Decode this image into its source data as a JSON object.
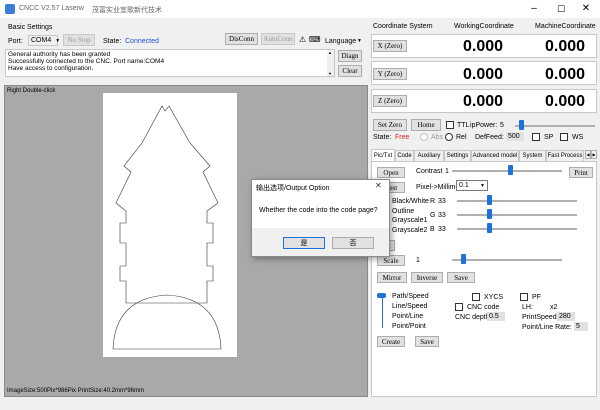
{
  "window": {
    "title": "CNCC V2.57 Laserw",
    "subtitle": "茂富实业宜歌新代技术"
  },
  "basic": {
    "section_label": "Basic Settings",
    "port_label": "Port:",
    "port_value": "COM4",
    "no_stop_label": "No Stop",
    "state_label": "State:",
    "state_value": "Connected",
    "disconn_label": "DisConn",
    "autoconn_label": "AutoConn",
    "language_label": "Language",
    "log_lines": [
      "General authority has been granted",
      "Successfully connected to the CNC. Port name:COM4",
      "Have access to configuration."
    ],
    "diagn_label": "Diagn",
    "clear_label": "Clear"
  },
  "canvas": {
    "hint": "Right Double-click",
    "status": "ImageSize:500Pix*986Pix  PrintSize:40.2mm*96mm"
  },
  "coords": {
    "system_label": "Coordinate System",
    "working_label": "WorkingCoordinate",
    "machine_label": "MachineCoordinate",
    "rows": [
      {
        "button": "X (Zero)",
        "working": "0.000",
        "machine": "0.000"
      },
      {
        "button": "Y (Zero)",
        "working": "0.000",
        "machine": "0.000"
      },
      {
        "button": "Z (Zero)",
        "working": "0.000",
        "machine": "0.000"
      }
    ]
  },
  "controls": {
    "set_zero": "Set Zero",
    "home": "Home",
    "ttl_label": "TTL",
    "ip_power_label": "ipPower:",
    "ip_power_value": "5",
    "state_label": "State:",
    "state_value": "Free",
    "abs_label": "Abs",
    "rel_label": "Rel",
    "def_feed_label": "DefFeed:",
    "def_feed_value": "500",
    "sp_label": "SP",
    "ws_label": "WS"
  },
  "tabs": [
    "Pic/Txt",
    "Code",
    "Auxiliary",
    "Settings",
    "Advanced model",
    "System",
    "Fast Process"
  ],
  "pic": {
    "open_label": "Open",
    "contrast_label": "Contrast",
    "contrast_value": "1",
    "print_label": "Print",
    "reset_label": "Rest",
    "pixel_label": "Pixel->Millimeter",
    "pixel_value": "0.1",
    "modes": [
      "Black/White",
      "Outline",
      "Grayscale1",
      "Grayscale2"
    ],
    "r_label": "R",
    "r_value": "33",
    "r_fraction": 0.13,
    "g_label": "G",
    "g_value": "33",
    "g_fraction": 0.13,
    "b_label": "B",
    "b_value": "33",
    "b_fraction": 0.13,
    "fr_label": "FR",
    "scale_label": "Scale",
    "scale_value": "1",
    "mirror_label": "Mirror",
    "inverse_label": "Inverse",
    "save_label": "Save",
    "path_options": [
      "Path/Speed",
      "Line/Speed",
      "Point/Line",
      "Point/Point"
    ],
    "xycs_label": "XYCS",
    "pf_label": "PF",
    "cnc_code_label": "CNC code",
    "lh_label": "LH:",
    "lh_value": "x2",
    "cnc_depth_label": "CNC depth:",
    "cnc_depth_value": "0.5",
    "print_speed_label": "PrintSpeed:",
    "print_speed_value": "280",
    "point_line_rate_label": "Point/Line Rate:",
    "point_line_rate_value": "5",
    "create_label": "Create",
    "save2_label": "Save"
  },
  "dialog": {
    "title": "输出选项/Output Option",
    "message": "Whether the code into the code page?",
    "yes_label": "是",
    "no_label": "否"
  }
}
